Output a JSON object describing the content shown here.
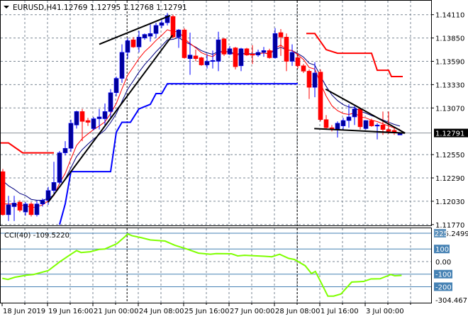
{
  "header": {
    "symbol_tf": "EURUSD,H4",
    "ohlc": "1.12769 1.12795 1.12768 1.12791"
  },
  "cci_header": "CCI(40) -109.5220",
  "chart_data": {
    "type": "candlestick",
    "symbol": "EURUSD",
    "timeframe": "H4",
    "current_price": 1.12791,
    "current_price_label": "1.12791",
    "price_ticks": [
      "1.14110",
      "1.13850",
      "1.13590",
      "1.13330",
      "1.13070",
      "1.12550",
      "1.12290",
      "1.12030",
      "1.11770"
    ],
    "ylim": [
      1.1177,
      1.1411
    ],
    "x_labels": [
      {
        "index": 0,
        "label": "18 Jun 2019"
      },
      {
        "index": 8,
        "label": "19 Jun 16:00"
      },
      {
        "index": 16,
        "label": "21 Jun 00:00"
      },
      {
        "index": 24,
        "label": "24 Jun 08:00"
      },
      {
        "index": 32,
        "label": "25 Jun 16:00"
      },
      {
        "index": 40,
        "label": "27 Jun 00:00"
      },
      {
        "index": 48,
        "label": "28 Jun 08:00"
      },
      {
        "index": 56,
        "label": "1 Jul 16:00"
      },
      {
        "index": 64,
        "label": "3 Jul 00:00"
      }
    ],
    "candles_ohlc": [
      [
        1.1236,
        1.1239,
        1.1187,
        1.1188
      ],
      [
        1.1188,
        1.1209,
        1.1181,
        1.1199
      ],
      [
        1.1197,
        1.1209,
        1.1181,
        1.1201
      ],
      [
        1.1202,
        1.1204,
        1.1191,
        1.1193
      ],
      [
        1.1191,
        1.1202,
        1.1187,
        1.12
      ],
      [
        1.12,
        1.1202,
        1.1186,
        1.1188
      ],
      [
        1.1188,
        1.1204,
        1.1186,
        1.12
      ],
      [
        1.12,
        1.1206,
        1.1197,
        1.1204
      ],
      [
        1.1204,
        1.1219,
        1.1199,
        1.1215
      ],
      [
        1.1215,
        1.1247,
        1.1211,
        1.1224
      ],
      [
        1.1224,
        1.1259,
        1.1222,
        1.1257
      ],
      [
        1.1257,
        1.127,
        1.1254,
        1.1262
      ],
      [
        1.1262,
        1.1294,
        1.1258,
        1.129
      ],
      [
        1.1288,
        1.1304,
        1.1284,
        1.1303
      ],
      [
        1.1303,
        1.1306,
        1.127,
        1.1292
      ],
      [
        1.1293,
        1.1296,
        1.1287,
        1.1291
      ],
      [
        1.1284,
        1.1297,
        1.1282,
        1.1295
      ],
      [
        1.1295,
        1.1306,
        1.1283,
        1.1297
      ],
      [
        1.1295,
        1.1312,
        1.1286,
        1.1303
      ],
      [
        1.1303,
        1.1328,
        1.1295,
        1.1324
      ],
      [
        1.1324,
        1.1342,
        1.132,
        1.134
      ],
      [
        1.134,
        1.1378,
        1.1335,
        1.1369
      ],
      [
        1.1369,
        1.1385,
        1.1362,
        1.1382
      ],
      [
        1.1383,
        1.1386,
        1.1374,
        1.1375
      ],
      [
        1.1375,
        1.1393,
        1.1369,
        1.1386
      ],
      [
        1.1385,
        1.139,
        1.1383,
        1.1389
      ],
      [
        1.1387,
        1.14,
        1.1381,
        1.139
      ],
      [
        1.139,
        1.1402,
        1.1385,
        1.1399
      ],
      [
        1.1399,
        1.1405,
        1.1396,
        1.1402
      ],
      [
        1.1402,
        1.1413,
        1.1399,
        1.141
      ],
      [
        1.1409,
        1.1411,
        1.1385,
        1.1386
      ],
      [
        1.1386,
        1.1395,
        1.1374,
        1.1394
      ],
      [
        1.1394,
        1.1396,
        1.1362,
        1.1363
      ],
      [
        1.1362,
        1.1391,
        1.1344,
        1.1366
      ],
      [
        1.1365,
        1.1372,
        1.1359,
        1.1362
      ],
      [
        1.1363,
        1.1364,
        1.1354,
        1.1355
      ],
      [
        1.1355,
        1.1367,
        1.1351,
        1.1359
      ],
      [
        1.1359,
        1.1371,
        1.1351,
        1.136
      ],
      [
        1.1359,
        1.1392,
        1.1348,
        1.1383
      ],
      [
        1.1384,
        1.1385,
        1.1365,
        1.1367
      ],
      [
        1.1367,
        1.1376,
        1.1366,
        1.1373
      ],
      [
        1.1374,
        1.1375,
        1.135,
        1.1353
      ],
      [
        1.1354,
        1.1374,
        1.1348,
        1.1373
      ],
      [
        1.1373,
        1.1374,
        1.1365,
        1.1366
      ],
      [
        1.1367,
        1.1377,
        1.1356,
        1.1366
      ],
      [
        1.1366,
        1.1372,
        1.1364,
        1.1369
      ],
      [
        1.1369,
        1.1375,
        1.1364,
        1.1371
      ],
      [
        1.1371,
        1.1373,
        1.1362,
        1.1363
      ],
      [
        1.1363,
        1.1396,
        1.1362,
        1.139
      ],
      [
        1.1391,
        1.1395,
        1.1365,
        1.1386
      ],
      [
        1.1386,
        1.139,
        1.1348,
        1.1359
      ],
      [
        1.1359,
        1.1378,
        1.1354,
        1.1369
      ],
      [
        1.1363,
        1.1368,
        1.1351,
        1.1354
      ],
      [
        1.1354,
        1.1356,
        1.1346,
        1.1348
      ],
      [
        1.1348,
        1.135,
        1.1317,
        1.133
      ],
      [
        1.133,
        1.1358,
        1.1319,
        1.1346
      ],
      [
        1.1347,
        1.135,
        1.1292,
        1.1294
      ],
      [
        1.1294,
        1.1299,
        1.1284,
        1.1285
      ],
      [
        1.1285,
        1.1288,
        1.1281,
        1.1283
      ],
      [
        1.1283,
        1.1292,
        1.1274,
        1.129
      ],
      [
        1.1287,
        1.1296,
        1.1283,
        1.1293
      ],
      [
        1.1293,
        1.1311,
        1.1285,
        1.1297
      ],
      [
        1.1297,
        1.1309,
        1.1288,
        1.1306
      ],
      [
        1.1306,
        1.1307,
        1.1283,
        1.1286
      ],
      [
        1.1284,
        1.1293,
        1.1283,
        1.1293
      ],
      [
        1.1293,
        1.1295,
        1.1286,
        1.1287
      ],
      [
        1.1287,
        1.129,
        1.1272,
        1.1288
      ],
      [
        1.1288,
        1.1303,
        1.1277,
        1.1283
      ],
      [
        1.1283,
        1.1303,
        1.1278,
        1.1281
      ],
      [
        1.1282,
        1.1286,
        1.1277,
        1.1279
      ],
      [
        1.12769,
        1.12795,
        1.12768,
        1.12791
      ]
    ],
    "upper_step_line": [
      [
        -0.5,
        1.1268
      ],
      [
        1,
        1.1268
      ],
      [
        3.5,
        1.1257
      ],
      [
        9,
        1.1257
      ],
      [
        null,
        null
      ],
      [
        53.5,
        1.139
      ],
      [
        55,
        1.139
      ],
      [
        57,
        1.1372
      ],
      [
        59,
        1.1368
      ],
      [
        65,
        1.1368
      ],
      [
        66,
        1.1349
      ],
      [
        68,
        1.1349
      ],
      [
        68.5,
        1.1342
      ],
      [
        70.5,
        1.1342
      ]
    ],
    "lower_step_line": [
      [
        10,
        1.1177
      ],
      [
        11,
        1.12
      ],
      [
        12,
        1.1236
      ],
      [
        19,
        1.1236
      ],
      [
        20,
        1.128
      ],
      [
        21,
        1.1291
      ],
      [
        22.5,
        1.1291
      ],
      [
        24,
        1.1306
      ],
      [
        26,
        1.1311
      ],
      [
        27,
        1.1323
      ],
      [
        28,
        1.1323
      ],
      [
        29,
        1.1334
      ],
      [
        52,
        1.1334
      ]
    ],
    "trend_lines": [
      [
        [
          17,
          1.1378
        ],
        [
          29.5,
          1.141
        ]
      ],
      [
        [
          8,
          1.1202
        ],
        [
          29.9,
          1.1388
        ]
      ],
      [
        [
          56.9,
          1.1328
        ],
        [
          70.9,
          1.1279
        ]
      ],
      [
        [
          54.9,
          1.1284
        ],
        [
          70.9,
          1.1279
        ]
      ]
    ],
    "cci": {
      "name": "CCI(40)",
      "current": -109.522,
      "max": 225.2499,
      "min": -304.4671,
      "axis_labels": [
        "225.2499",
        "100",
        "0.00",
        "-100",
        "-200",
        "-304.4671"
      ],
      "boxed_label_top": "225",
      "levels": [
        100,
        -100,
        -200
      ],
      "points": [
        [
          -0.1,
          -133
        ],
        [
          0.9,
          -142
        ],
        [
          2.1,
          -125
        ],
        [
          4.2,
          -108
        ],
        [
          5.4,
          -103
        ],
        [
          8,
          -72
        ],
        [
          10.1,
          0
        ],
        [
          12,
          58
        ],
        [
          13,
          87
        ],
        [
          13.8,
          72
        ],
        [
          15.4,
          78
        ],
        [
          17,
          97
        ],
        [
          18,
          100
        ],
        [
          20.1,
          142
        ],
        [
          21.5,
          197
        ],
        [
          22,
          220
        ],
        [
          22.8,
          205
        ],
        [
          24.4,
          190
        ],
        [
          26,
          172
        ],
        [
          28.6,
          163
        ],
        [
          30.3,
          130
        ],
        [
          32.4,
          100
        ],
        [
          34.5,
          67
        ],
        [
          36.6,
          58
        ],
        [
          37.6,
          63
        ],
        [
          40.3,
          62
        ],
        [
          41.4,
          45
        ],
        [
          42.6,
          50
        ],
        [
          46.1,
          42
        ],
        [
          47.4,
          38
        ],
        [
          48.8,
          58
        ],
        [
          50.4,
          25
        ],
        [
          51.4,
          17
        ],
        [
          53.3,
          -33
        ],
        [
          54.4,
          -95
        ],
        [
          55.1,
          -78
        ],
        [
          56.1,
          -167
        ],
        [
          57.3,
          -275
        ],
        [
          58.3,
          -275
        ],
        [
          59.6,
          -258
        ],
        [
          61.5,
          -163
        ],
        [
          63.6,
          -158
        ],
        [
          64.9,
          -138
        ],
        [
          66.5,
          -137
        ],
        [
          68.4,
          -103
        ],
        [
          69.1,
          -113
        ],
        [
          70.3,
          -110
        ]
      ]
    }
  }
}
